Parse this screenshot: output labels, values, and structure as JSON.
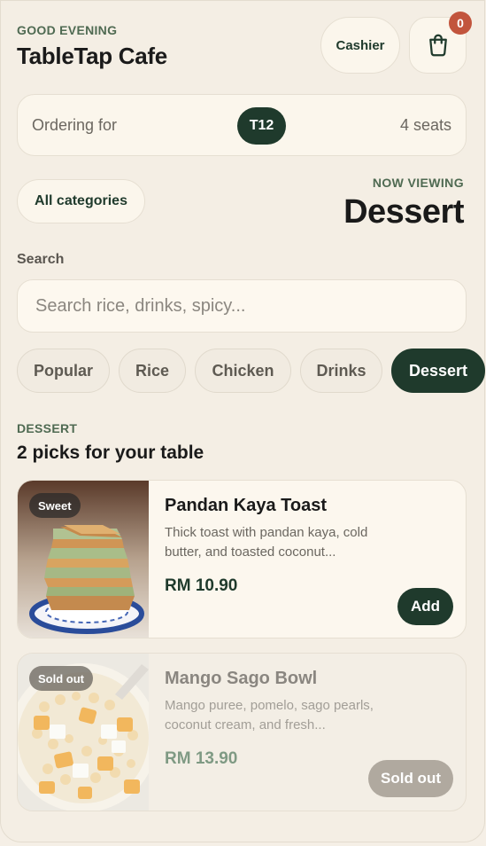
{
  "header": {
    "greeting": "GOOD EVENING",
    "title": "TableTap Cafe",
    "cashier_label": "Cashier",
    "cart_count": "0",
    "cart_icon": "shopping-bag-icon"
  },
  "ordering": {
    "label": "Ordering for",
    "table": "T12",
    "seats": "4 seats"
  },
  "categories": {
    "all_label": "All categories",
    "now_viewing_label": "NOW VIEWING",
    "current": "Dessert"
  },
  "search": {
    "label": "Search",
    "placeholder": "Search rice, drinks, spicy...",
    "value": ""
  },
  "chips": [
    {
      "label": "Popular",
      "active": false
    },
    {
      "label": "Rice",
      "active": false
    },
    {
      "label": "Chicken",
      "active": false
    },
    {
      "label": "Drinks",
      "active": false
    },
    {
      "label": "Dessert",
      "active": true
    }
  ],
  "section": {
    "eyebrow": "DESSERT",
    "title": "2 picks for your table"
  },
  "items": [
    {
      "name": "Pandan Kaya Toast",
      "description": "Thick toast with pandan kaya, cold butter, and toasted coconut...",
      "price": "RM 10.90",
      "badge": "Sweet",
      "action": "Add",
      "sold_out": false
    },
    {
      "name": "Mango Sago Bowl",
      "description": "Mango puree, pomelo, sago pearls, coconut cream, and fresh...",
      "price": "RM 13.90",
      "badge": "Sold out",
      "action": "Sold out",
      "sold_out": true
    }
  ],
  "colors": {
    "background": "#f4eee4",
    "accent": "#1f3a2c",
    "badge": "#c2553d",
    "eyebrow": "#4f6a52"
  }
}
